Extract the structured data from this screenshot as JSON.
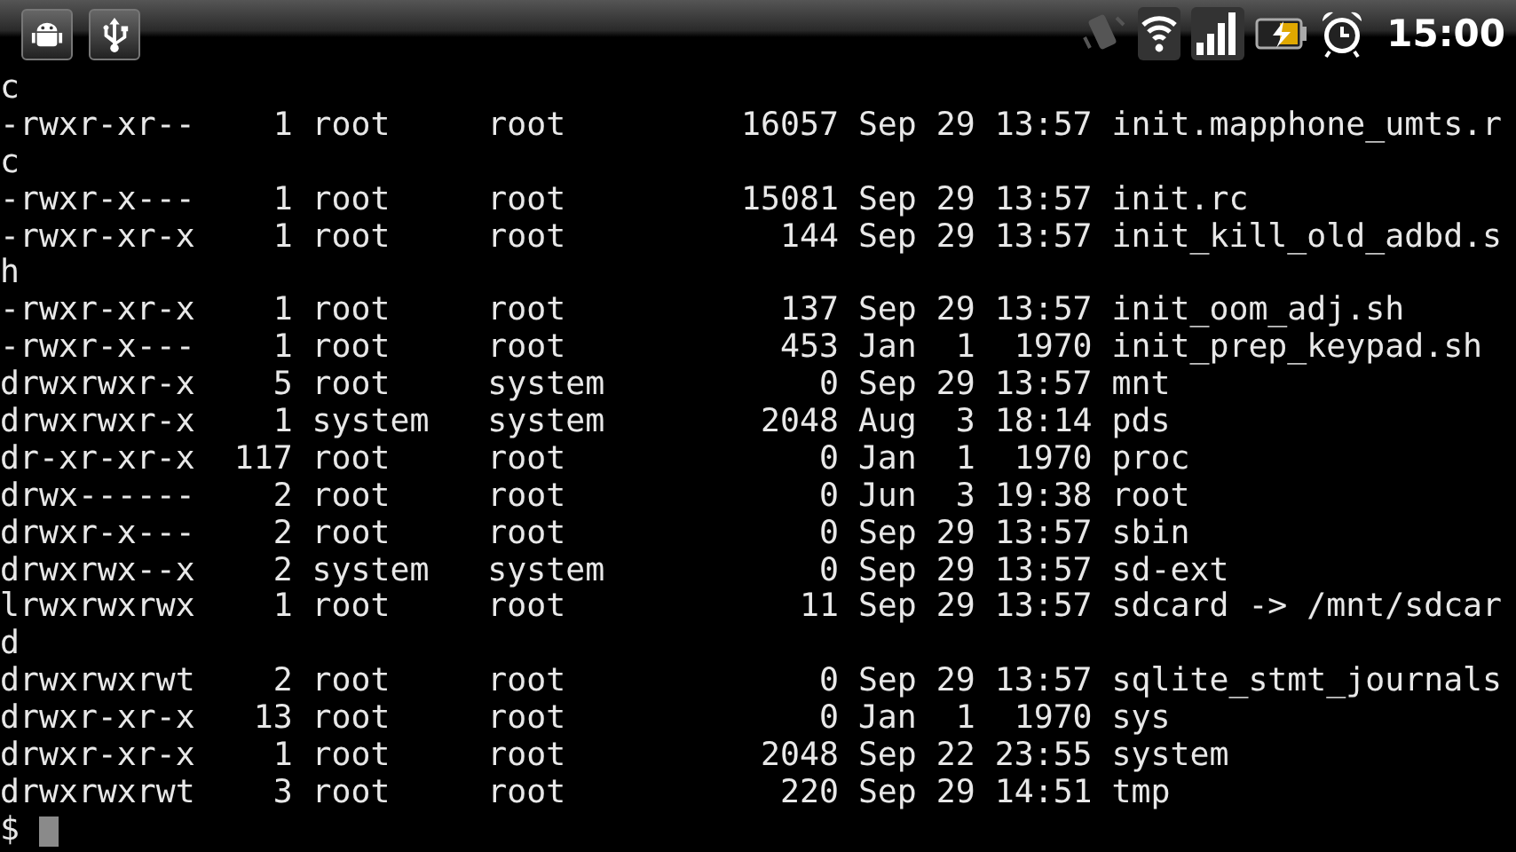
{
  "status_bar": {
    "time": "15:00"
  },
  "terminal": {
    "lines": [
      "c",
      "-rwxr-xr--    1 root     root         16057 Sep 29 13:57 init.mapphone_umts.r",
      "c",
      "-rwxr-x---    1 root     root         15081 Sep 29 13:57 init.rc",
      "-rwxr-xr-x    1 root     root           144 Sep 29 13:57 init_kill_old_adbd.s",
      "h",
      "-rwxr-xr-x    1 root     root           137 Sep 29 13:57 init_oom_adj.sh",
      "-rwxr-x---    1 root     root           453 Jan  1  1970 init_prep_keypad.sh",
      "drwxrwxr-x    5 root     system           0 Sep 29 13:57 mnt",
      "drwxrwxr-x    1 system   system        2048 Aug  3 18:14 pds",
      "dr-xr-xr-x  117 root     root             0 Jan  1  1970 proc",
      "drwx------    2 root     root             0 Jun  3 19:38 root",
      "drwxr-x---    2 root     root             0 Sep 29 13:57 sbin",
      "drwxrwx--x    2 system   system           0 Sep 29 13:57 sd-ext",
      "lrwxrwxrwx    1 root     root            11 Sep 29 13:57 sdcard -> /mnt/sdcar",
      "d",
      "drwxrwxrwt    2 root     root             0 Sep 29 13:57 sqlite_stmt_journals",
      "drwxr-xr-x   13 root     root             0 Jan  1  1970 sys",
      "drwxr-xr-x    1 root     root          2048 Sep 22 23:55 system",
      "drwxrwxrwt    3 root     root           220 Sep 29 14:51 tmp"
    ],
    "prompt": "$"
  }
}
